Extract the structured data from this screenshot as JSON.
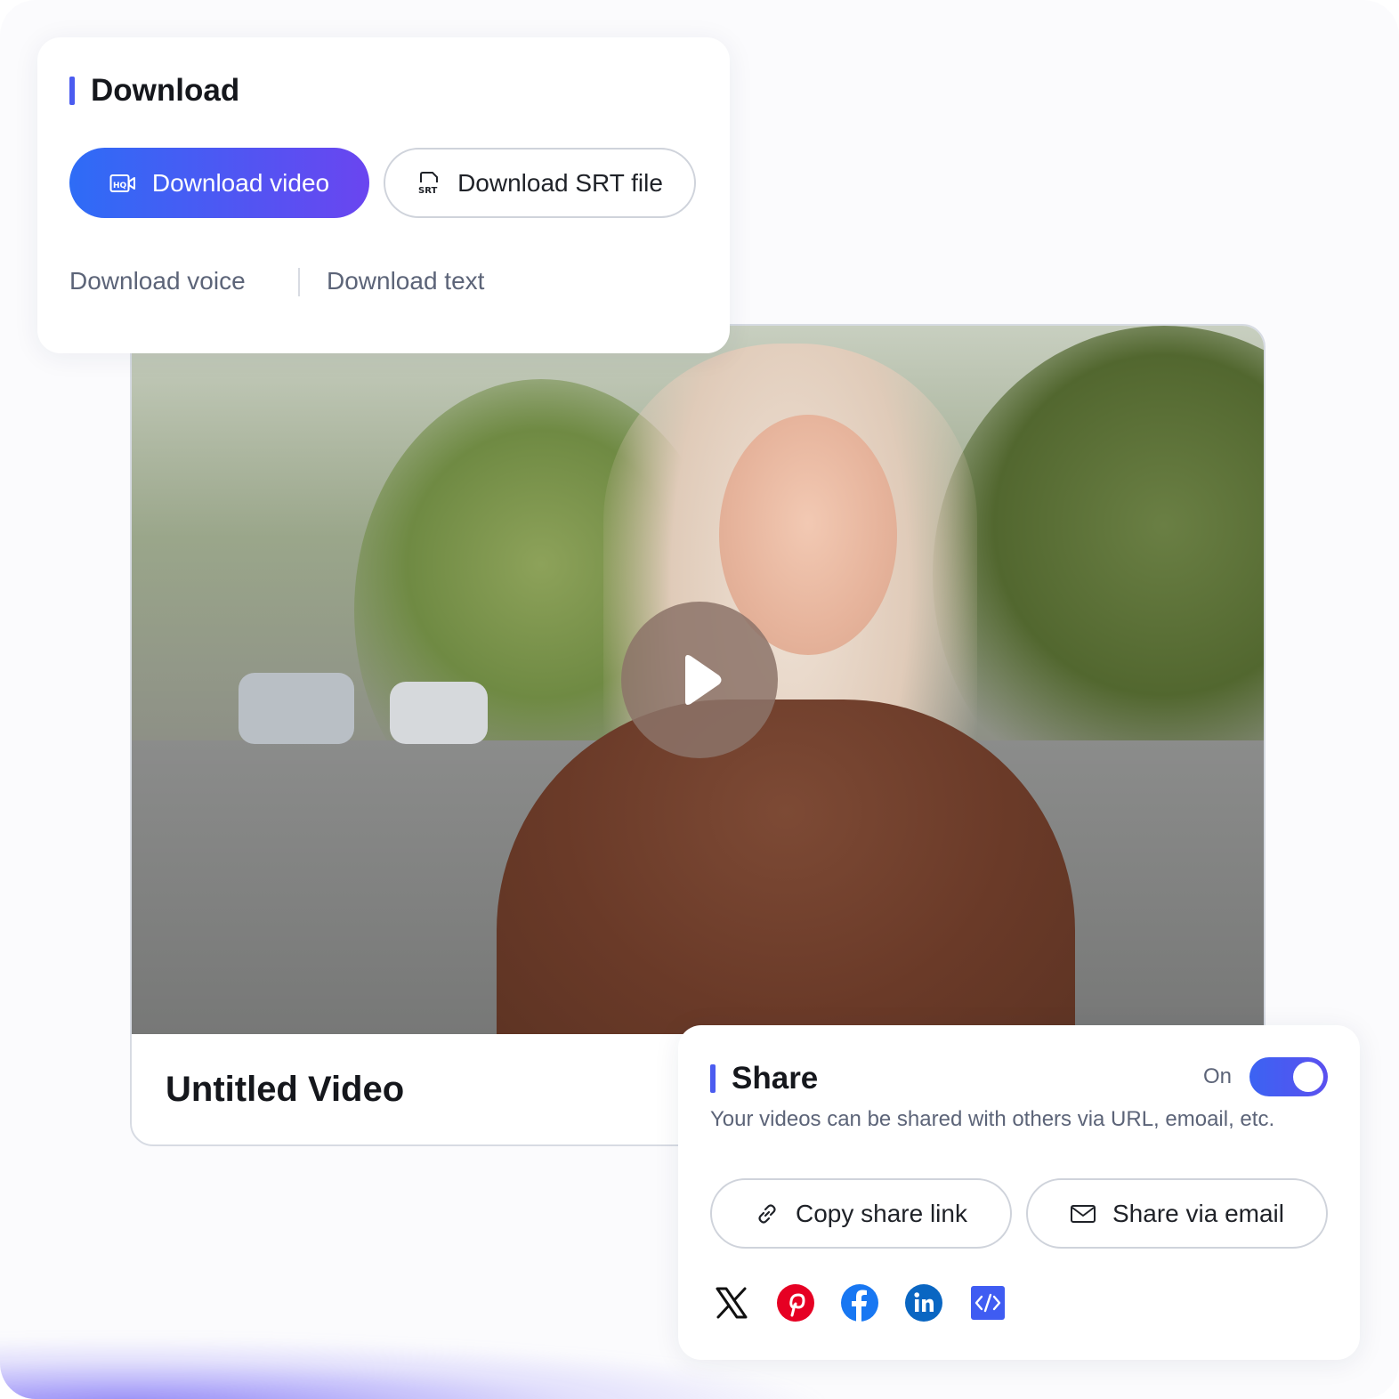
{
  "download": {
    "title": "Download",
    "download_video_label": "Download video",
    "download_srt_label": "Download SRT file",
    "download_voice_label": "Download voice",
    "download_text_label": "Download text"
  },
  "video": {
    "title": "Untitled Video"
  },
  "share": {
    "title": "Share",
    "toggle_label": "On",
    "toggle_on": true,
    "description": "Your videos can be shared with others via URL, emoail, etc.",
    "copy_link_label": "Copy share link",
    "email_label": "Share via email",
    "social_icons": [
      "x-icon",
      "pinterest-icon",
      "facebook-icon",
      "linkedin-icon",
      "embed-code-icon"
    ]
  },
  "colors": {
    "accent": "#4b5cf0",
    "primary_gradient_start": "#2e6cf6",
    "primary_gradient_end": "#6a45f0",
    "pinterest": "#e60023",
    "facebook": "#1877f2",
    "linkedin": "#0a66c2"
  }
}
